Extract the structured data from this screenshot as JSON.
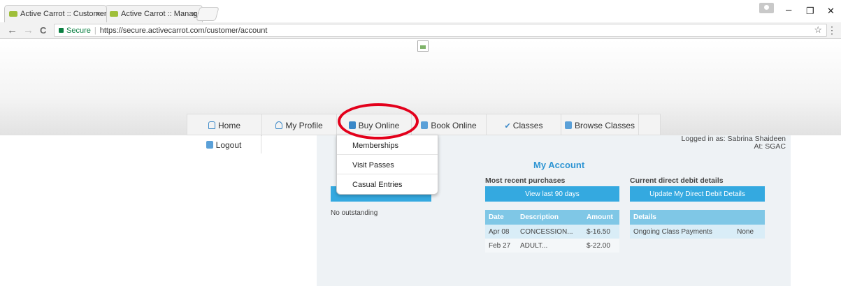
{
  "browser": {
    "tabs": [
      {
        "title": "Active Carrot :: Customer",
        "close": "×"
      },
      {
        "title": "Active Carrot :: Manager",
        "close": "×"
      }
    ],
    "window_controls": {
      "minimize": "–",
      "restore": "❐",
      "close": "✕"
    },
    "nav": {
      "back": "←",
      "forward": "→",
      "reload": "C"
    },
    "secure_label": "Secure",
    "url": "https://secure.activecarrot.com/customer/account",
    "bookmark_star": "☆",
    "menu": "⋮"
  },
  "nav_menu": {
    "items": [
      {
        "label": "Home",
        "icon": "home-icon"
      },
      {
        "label": "My Profile",
        "icon": "profile-icon"
      },
      {
        "label": "Buy Online",
        "icon": "cart-icon"
      },
      {
        "label": "Book Online",
        "icon": "book-icon"
      },
      {
        "label": "Classes",
        "icon": "check-icon"
      },
      {
        "label": "Browse Classes",
        "icon": "browse-icon"
      }
    ],
    "logout": {
      "label": "Logout",
      "icon": "logout-icon"
    }
  },
  "dropdown": {
    "items": [
      "Memberships",
      "Visit Passes",
      "Casual Entries"
    ]
  },
  "account": {
    "logged_in_line": "Logged in as: Sabrina Shaideen",
    "at_line": "At: SGAC",
    "title": "My Account",
    "no_outstanding": "No outstanding",
    "purchases": {
      "heading": "Most recent purchases",
      "button": "View last 90 days",
      "columns": [
        "Date",
        "Description",
        "Amount"
      ],
      "rows": [
        {
          "date": "Apr 08",
          "description": "CONCESSION...",
          "amount": "$-16.50"
        },
        {
          "date": "Feb 27",
          "description": "ADULT...",
          "amount": "$-22.00"
        }
      ]
    },
    "debit": {
      "heading": "Current direct debit details",
      "button": "Update My Direct Debit Details",
      "columns": [
        "Details"
      ],
      "rows": [
        {
          "details": "Ongoing Class Payments",
          "value": "None"
        }
      ]
    }
  },
  "colors": {
    "accent_blue": "#34a9e0",
    "title_blue": "#2e95d3",
    "table_header": "#7fc7e6",
    "highlight_red": "#e3001b"
  }
}
